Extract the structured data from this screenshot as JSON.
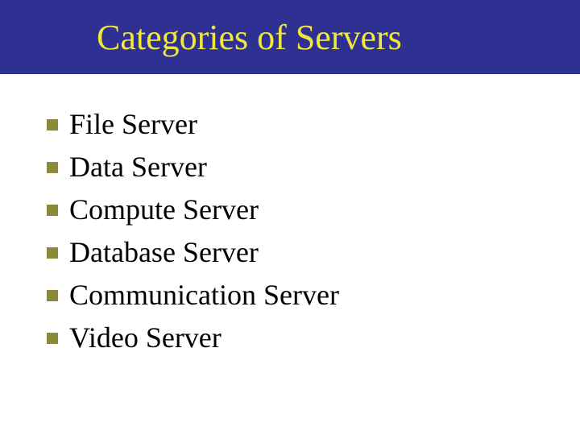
{
  "title": "Categories of Servers",
  "items": [
    "File Server",
    "Data Server",
    "Compute Server",
    "Database Server",
    "Communication Server",
    "Video Server"
  ]
}
